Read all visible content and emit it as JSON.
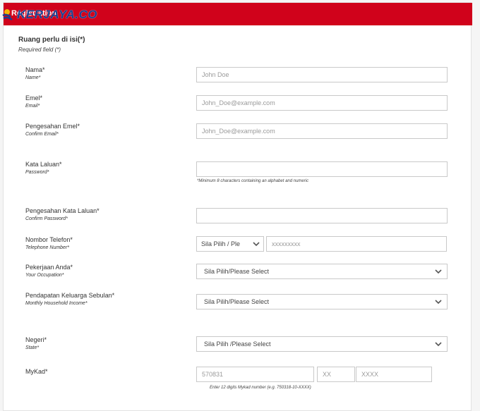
{
  "header": {
    "title": "Registration",
    "logo_text": "KERJAYA.CO"
  },
  "required": {
    "title": "Ruang perlu di isi(*)",
    "subtitle": "Required field (*)"
  },
  "fields": {
    "name": {
      "label_ms": "Nama*",
      "label_en": "Name*",
      "placeholder": "John Doe"
    },
    "email": {
      "label_ms": "Emel*",
      "label_en": "Email*",
      "placeholder": "John_Doe@example.com"
    },
    "confirm_email": {
      "label_ms": "Pengesahan Emel*",
      "label_en": "Confirm Email*",
      "placeholder": "John_Doe@example.com"
    },
    "password": {
      "label_ms": "Kata Laluan*",
      "label_en": "Password*",
      "placeholder": "",
      "hint": "*Minimum 8 characters containing an alphabet and numeric"
    },
    "confirm_password": {
      "label_ms": "Pengesahan Kata Laluan*",
      "label_en": "Confirm Password*",
      "placeholder": ""
    },
    "phone": {
      "label_ms": "Nombor Telefon*",
      "label_en": "Telephone Number*",
      "prefix_select": "Sila Pilih / Ple",
      "placeholder": "xxxxxxxxx"
    },
    "occupation": {
      "label_ms": "Pekerjaan Anda*",
      "label_en": "Your Occupation*",
      "selected": "Sila Pilih/Please Select"
    },
    "income": {
      "label_ms": "Pendapatan Keluarga Sebulan*",
      "label_en": "Monthly Household Income*",
      "selected": "Sila Pilih/Please Select"
    },
    "state": {
      "label_ms": "Negeri*",
      "label_en": "State*",
      "selected": "Sila Pilih /Please Select"
    },
    "mykad": {
      "label_ms": "MyKad*",
      "part1": "570831",
      "part2": "XX",
      "part3": "XXXX",
      "hint": "Enter 12 digits Mykad number (e.g. 750318-10-XXXX)"
    }
  },
  "colors": {
    "header_red": "#d0021b",
    "logo_blue": "#1b3f8f"
  }
}
